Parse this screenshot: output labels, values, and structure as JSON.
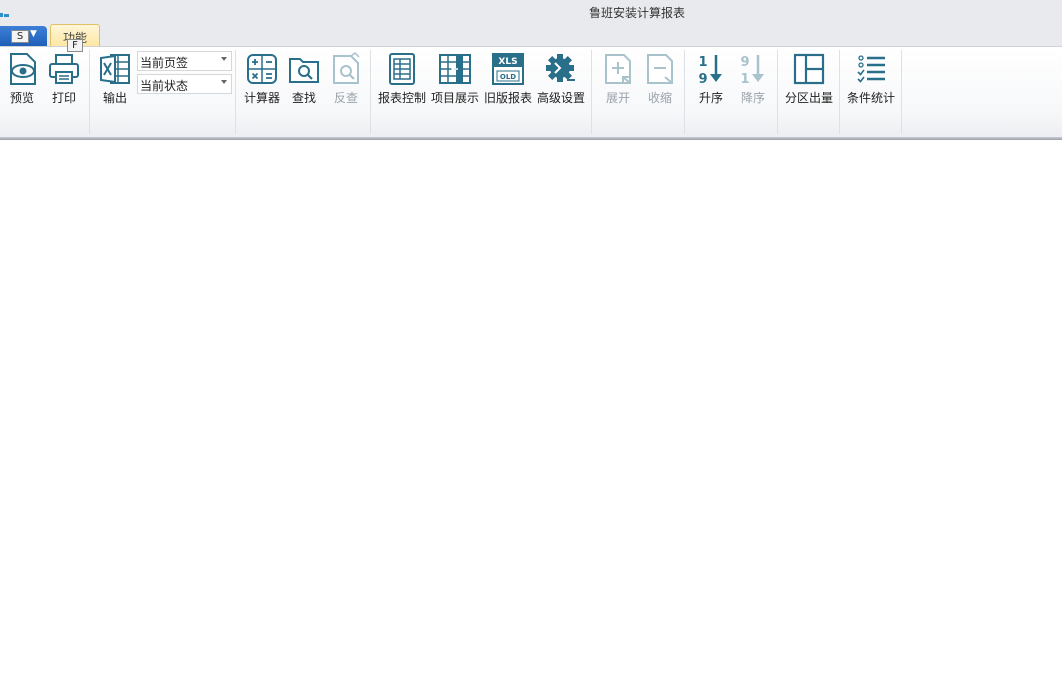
{
  "window": {
    "title": "鲁班安装计算报表"
  },
  "tabs": {
    "file_keytip": "S",
    "function_label": "功能",
    "function_keytip": "F"
  },
  "ribbon": {
    "preview": "预览",
    "print": "打印",
    "export": "输出",
    "page_scope_value": "当前页签",
    "state_scope_value": "当前状态",
    "calculator": "计算器",
    "find": "查找",
    "reverse_find": "反查",
    "report_control": "报表控制",
    "item_display": "项目展示",
    "old_report": "旧版报表",
    "advanced_settings": "高级设置",
    "expand": "展开",
    "collapse": "收缩",
    "ascending": "升序",
    "descending": "降序",
    "partition_output": "分区出量",
    "conditional_stats": "条件统计"
  },
  "icons": {
    "xls_text": "XLS",
    "old_text": "OLD",
    "sort_asc_top": "1",
    "sort_asc_bottom": "9",
    "sort_desc_top": "9",
    "sort_desc_bottom": "1"
  },
  "colors": {
    "icon": "#2a6f8a",
    "disabled": "#a9c3cd",
    "file_tab": "#2d6fc6",
    "active_tab": "#fde7a4"
  }
}
